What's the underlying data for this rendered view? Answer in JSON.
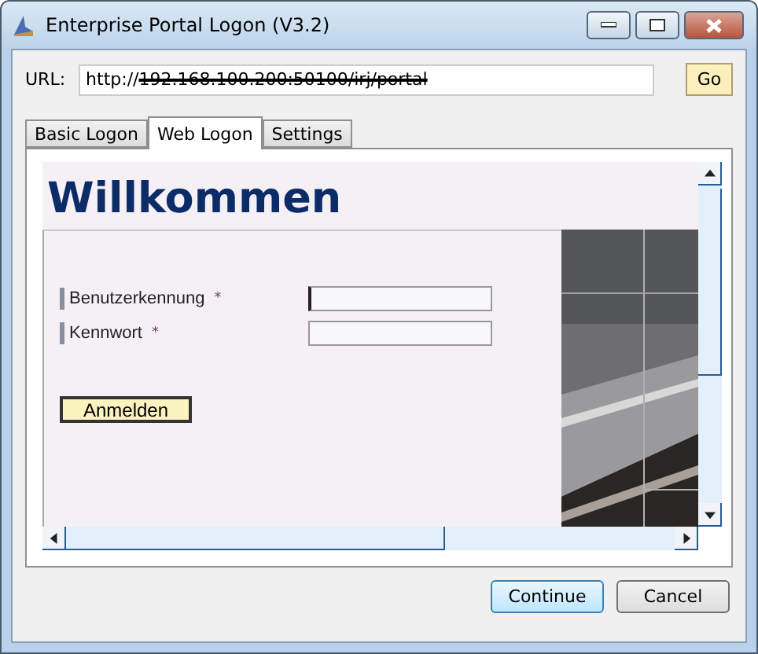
{
  "window": {
    "title": "Enterprise Portal Logon (V3.2)"
  },
  "url": {
    "label": "URL:",
    "prefix": "http://",
    "struck": "192.168.100.200:50100/irj/portal",
    "go": "Go"
  },
  "tabs": [
    {
      "label": "Basic Logon",
      "selected": false
    },
    {
      "label": "Web Logon",
      "selected": true
    },
    {
      "label": "Settings",
      "selected": false
    }
  ],
  "web": {
    "heading": "Willkommen",
    "fields": [
      {
        "label": "Benutzerkennung",
        "required_mark": "*",
        "focused": true
      },
      {
        "label": "Kennwort",
        "required_mark": "*",
        "focused": false
      }
    ],
    "submit": "Anmelden"
  },
  "buttons": [
    {
      "label": "Continue",
      "default": true
    },
    {
      "label": "Cancel",
      "default": false
    }
  ]
}
